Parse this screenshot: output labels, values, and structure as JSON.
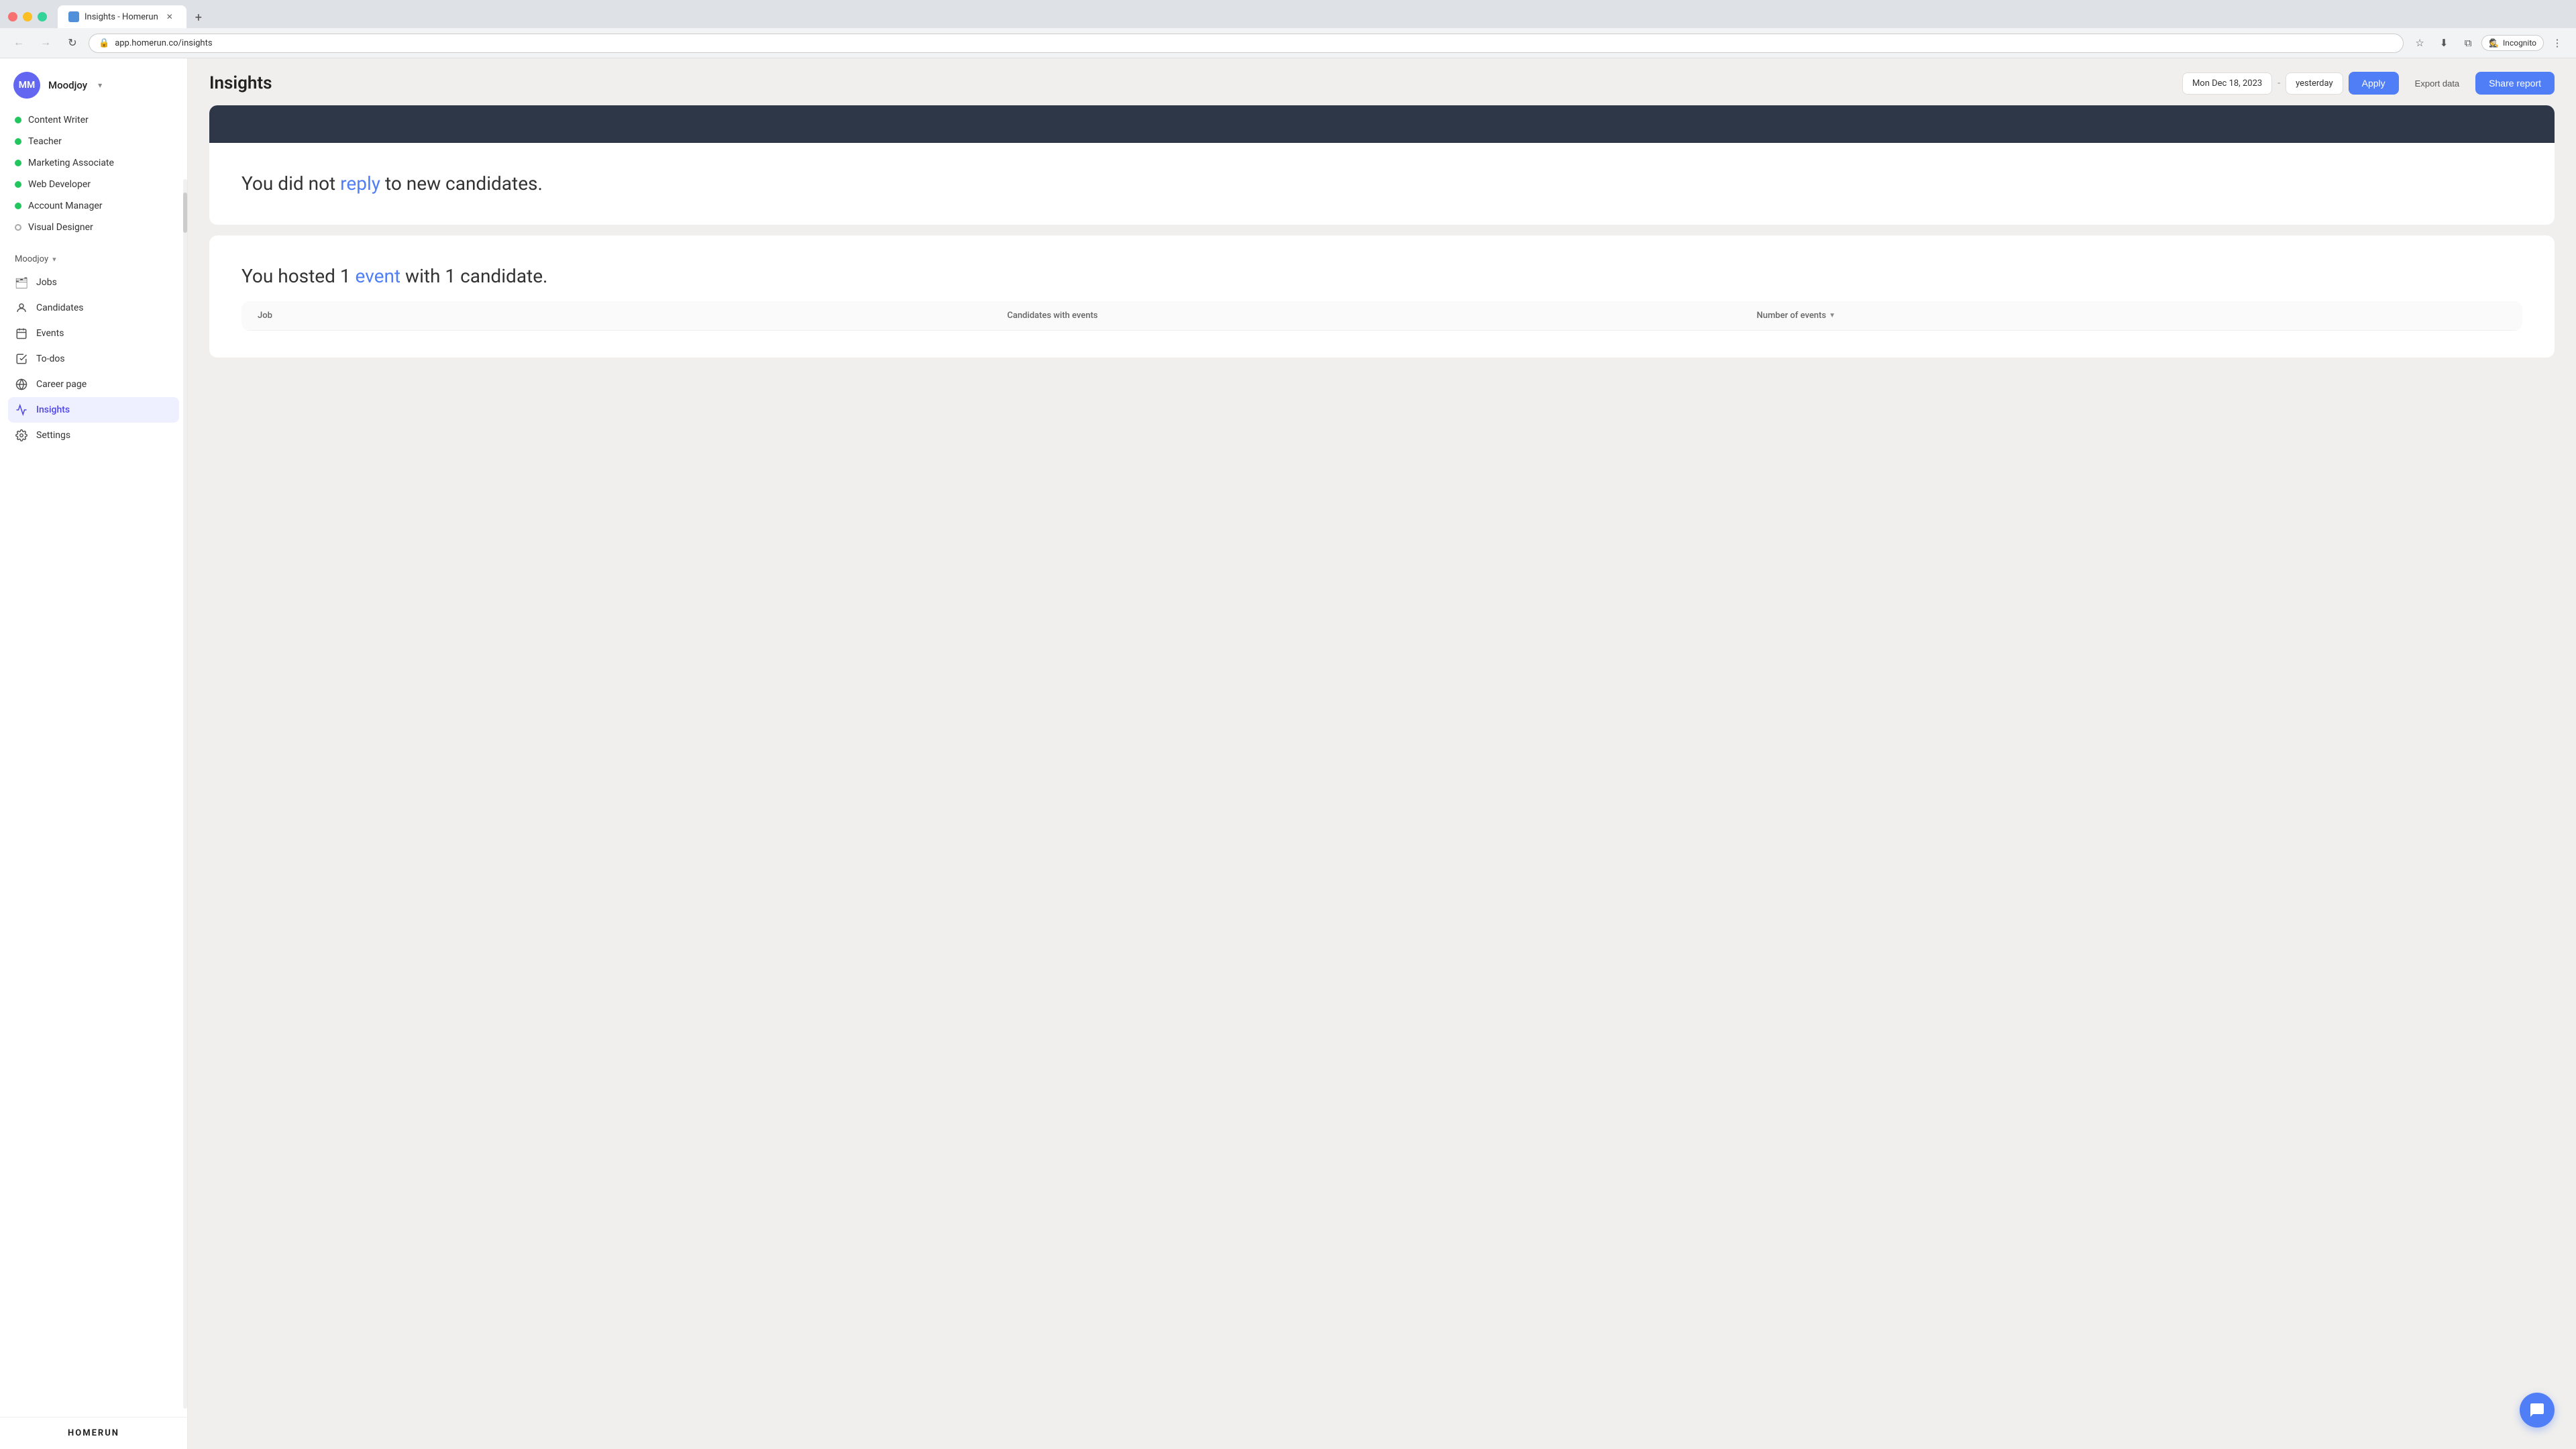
{
  "browser": {
    "tab_title": "Insights - Homerun",
    "tab_favicon": "H",
    "url": "app.homerun.co/insights",
    "new_tab_label": "+",
    "incognito_label": "Incognito"
  },
  "sidebar": {
    "user": {
      "initials": "MM",
      "name": "Moodjoy",
      "chevron": "▾"
    },
    "jobs": [
      {
        "label": "Content Writer",
        "status": "active"
      },
      {
        "label": "Teacher",
        "status": "active"
      },
      {
        "label": "Marketing Associate",
        "status": "active"
      },
      {
        "label": "Web Developer",
        "status": "active"
      },
      {
        "label": "Account Manager",
        "status": "active"
      },
      {
        "label": "Visual Designer",
        "status": "inactive"
      }
    ],
    "section_label": "Moodjoy",
    "nav_items": [
      {
        "id": "jobs",
        "label": "Jobs",
        "icon": "🗂"
      },
      {
        "id": "candidates",
        "label": "Candidates",
        "icon": "👤"
      },
      {
        "id": "events",
        "label": "Events",
        "icon": "📅"
      },
      {
        "id": "todos",
        "label": "To-dos",
        "icon": "✅"
      },
      {
        "id": "career-page",
        "label": "Career page",
        "icon": "🌐"
      },
      {
        "id": "insights",
        "label": "Insights",
        "icon": "📈",
        "active": true
      },
      {
        "id": "settings",
        "label": "Settings",
        "icon": "⚙"
      }
    ],
    "logo": "HOMERUN"
  },
  "header": {
    "page_title": "Insights",
    "date_start": "Mon Dec 18, 2023",
    "date_separator": "-",
    "date_end": "yesterday",
    "apply_label": "Apply",
    "export_label": "Export data",
    "share_label": "Share report"
  },
  "cards": [
    {
      "id": "reply-card",
      "text_before": "You did not ",
      "link_text": "reply",
      "text_after": " to new candidates.",
      "has_dark_top": true
    },
    {
      "id": "events-card",
      "text_before": "You hosted 1 ",
      "link_text": "event",
      "text_after": " with 1 candidate."
    }
  ],
  "table": {
    "columns": [
      {
        "id": "job",
        "label": "Job"
      },
      {
        "id": "candidates",
        "label": "Candidates with events"
      },
      {
        "id": "events",
        "label": "Number of events",
        "sortable": true
      }
    ]
  },
  "chat_btn": "💬"
}
